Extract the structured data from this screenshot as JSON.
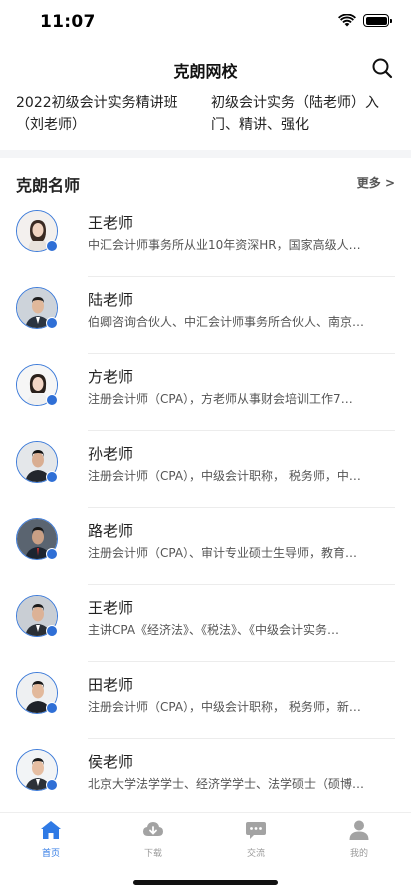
{
  "status_bar": {
    "time": "11:07",
    "icons": [
      "wifi-icon",
      "battery-icon"
    ]
  },
  "header": {
    "title": "克朗网校",
    "search_icon": "search-icon"
  },
  "courses": [
    {
      "title": "2022初级会计实务精讲班（刘老师）"
    },
    {
      "title": "初级会计实务（陆老师）入门、精讲、强化"
    }
  ],
  "section": {
    "title": "克朗名师",
    "more_label": "更多 >"
  },
  "teachers": [
    {
      "name": "王老师",
      "desc": "中汇会计师事务所从业10年资深HR，国家高级人…"
    },
    {
      "name": "陆老师",
      "desc": "伯卿咨询合伙人、中汇会计师事务所合伙人、南京…"
    },
    {
      "name": "方老师",
      "desc": "注册会计师（CPA），方老师从事财会培训工作7…"
    },
    {
      "name": "孙老师",
      "desc": "注册会计师（CPA），中级会计职称， 税务师，中…"
    },
    {
      "name": "路老师",
      "desc": "注册会计师（CPA）、审计专业硕士生导师，教育…"
    },
    {
      "name": "王老师",
      "desc": "主讲CPA《经济法》、《税法》、《中级会计实务…"
    },
    {
      "name": "田老师",
      "desc": "注册会计师（CPA），中级会计职称， 税务师，新…"
    },
    {
      "name": "侯老师",
      "desc": "北京大学法学学士、经济学学士、法学硕士（硕博…"
    }
  ],
  "tabs": [
    {
      "label": "首页",
      "icon": "home-icon",
      "active": true
    },
    {
      "label": "下载",
      "icon": "download-cloud-icon",
      "active": false
    },
    {
      "label": "交流",
      "icon": "chat-bubble-icon",
      "active": false
    },
    {
      "label": "我的",
      "icon": "user-icon",
      "active": false
    }
  ],
  "colors": {
    "accent": "#2f7ae5",
    "inactive": "#9a9a9a",
    "avatar_ring": "#3d7bd9"
  }
}
